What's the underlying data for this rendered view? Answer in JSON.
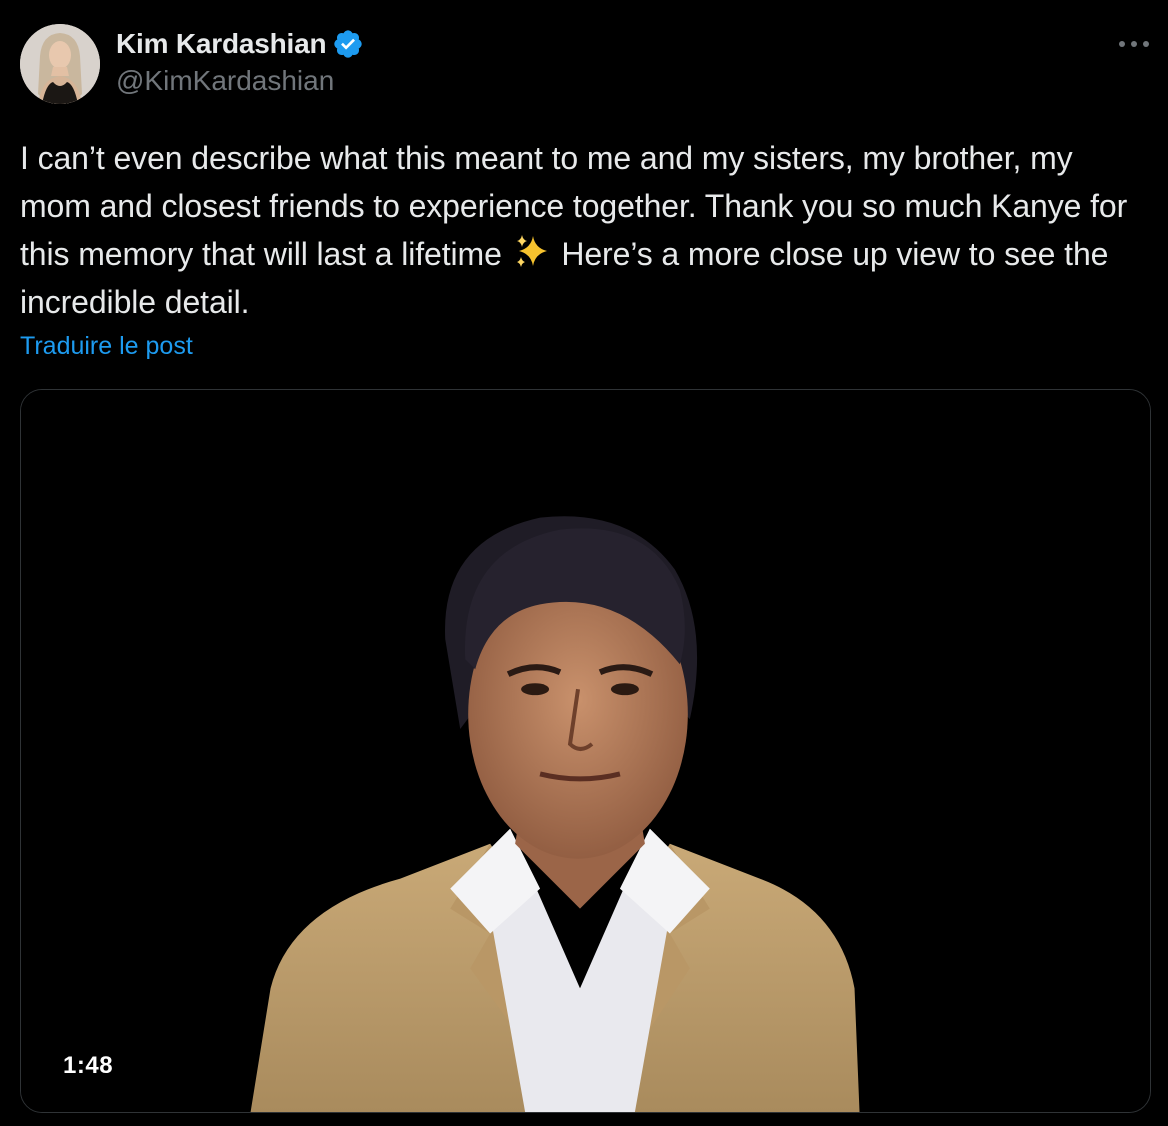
{
  "author": {
    "display_name": "Kim Kardashian",
    "handle": "@KimKardashian",
    "verified": true
  },
  "icons": {
    "verified": "verified-badge-icon",
    "more": "more-options-icon",
    "sparkles": "sparkles-emoji"
  },
  "tweet": {
    "text_part1": "I can’t even describe what this meant to me and my sisters, my brother, my mom and closest friends to experience together. Thank you so much Kanye for this memory that will last a lifetime ",
    "text_part2": " Here’s a more close up view to see the incredible detail.",
    "translate_label": "Traduire le post"
  },
  "media": {
    "type": "video",
    "duration": "1:48"
  },
  "colors": {
    "background": "#000000",
    "text_primary": "#e7e9ea",
    "text_secondary": "#71767b",
    "accent": "#1d9bf0",
    "border": "#2f3336"
  }
}
